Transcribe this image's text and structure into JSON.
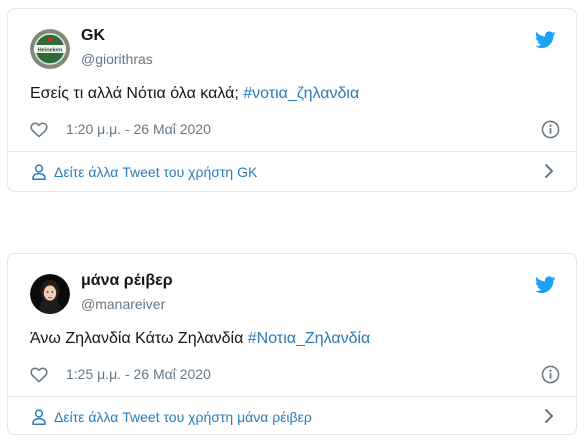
{
  "tweets": [
    {
      "display_name": "GK",
      "handle": "@giorithras",
      "text_plain": "Εσείς τι αλλά Νότια όλα καλά; ",
      "hashtag": "#νοτια_ζηλανδια",
      "timestamp": "1:20 μ.μ. - 26 Μαΐ 2020",
      "more_tweets_label": "Δείτε άλλα Tweet του χρήστη GK",
      "avatar_badge_text": "Heineken"
    },
    {
      "display_name": "μάνα ρέιβερ",
      "handle": "@manareiver",
      "text_plain": "Άνω Ζηλανδία Κάτω Ζηλανδία ",
      "hashtag": "#Νοτια_Ζηλανδία",
      "timestamp": "1:25 μ.μ. - 26 Μαΐ 2020",
      "more_tweets_label": "Δείτε άλλα Tweet του χρήστη μάνα ρέιβερ"
    }
  ],
  "colors": {
    "link": "#2b7bb9",
    "twitter_blue": "#1da1f2",
    "secondary_text": "#657786",
    "border": "#e1e8ed",
    "primary_text": "#14171a"
  },
  "icons": {
    "brand": "twitter-bird-icon",
    "like": "heart-icon",
    "info": "info-icon",
    "profile": "person-icon",
    "navigate": "chevron-right-icon"
  }
}
